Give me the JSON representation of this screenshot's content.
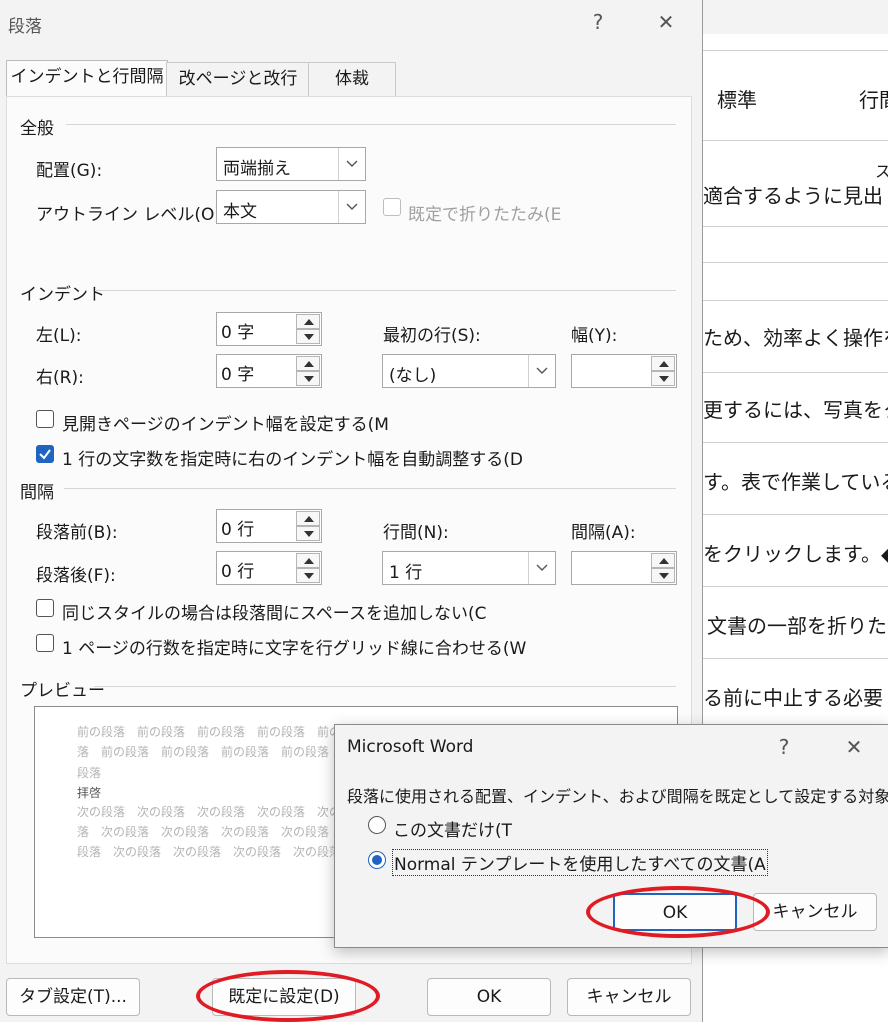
{
  "document": {
    "lines": [
      "標準",
      "行間",
      "ス",
      "適合するように見出",
      "ため、効率よく操作を",
      "更するには、写真をク",
      "す。表で作業している",
      "をクリックします。◆",
      "文書の一部を折りた",
      "る前に中止する必要"
    ]
  },
  "paragraph_dialog": {
    "title": "段落",
    "help": "?",
    "close": "✕",
    "tabs": [
      "インデントと行間隔",
      "改ページと改行",
      "体裁"
    ],
    "general": {
      "heading": "全般",
      "alignment_label": "配置(G):",
      "alignment_value": "両端揃え",
      "outline_label": "アウトライン レベル(O):",
      "outline_value": "本文",
      "collapse_label": "既定で折りたたみ(E"
    },
    "indent": {
      "heading": "インデント",
      "left_label": "左(L):",
      "left_value": "0 字",
      "right_label": "右(R):",
      "right_value": "0 字",
      "first_line_label": "最初の行(S):",
      "first_line_value": "(なし)",
      "width_label": "幅(Y):",
      "width_value": "",
      "mirror_label": "見開きページのインデント幅を設定する(M",
      "auto_adjust_label": "1 行の文字数を指定時に右のインデント幅を自動調整する(D"
    },
    "spacing": {
      "heading": "間隔",
      "before_label": "段落前(B):",
      "before_value": "0 行",
      "after_label": "段落後(F):",
      "after_value": "0 行",
      "line_label": "行間(N):",
      "line_value": "1 行",
      "at_label": "間隔(A):",
      "at_value": "",
      "no_space_label": "同じスタイルの場合は段落間にスペースを追加しない(C",
      "snap_grid_label": "1 ページの行数を指定時に文字を行グリッド線に合わせる(W"
    },
    "preview": {
      "heading": "プレビュー",
      "lines": [
        "前の段落　前の段落　前の段落　前の段落　前の段落",
        "落　前の段落　前の段落　前の段落　前の段落　前の段落",
        "段落",
        "拝啓",
        "次の段落　次の段落　次の段落　次の段落　次の段落",
        "落　次の段落　次の段落　次の段落　次の段落　次の段落",
        "段落　次の段落　次の段落　次の段落　次の段落　次の段落"
      ]
    },
    "buttons": {
      "tabs": "タブ設定(T)...",
      "set_default": "既定に設定(D)",
      "ok": "OK",
      "cancel": "キャンセル"
    }
  },
  "word_dialog": {
    "title": "Microsoft Word",
    "help": "?",
    "close": "✕",
    "message": "段落に使用される配置、インデント、および間隔を既定として設定する対象:",
    "option_this_doc": "この文書だけ(T",
    "option_normal": "Normal テンプレートを使用したすべての文書(A",
    "ok": "OK",
    "cancel": "キャンセル"
  },
  "colors": {
    "accent": "#1f64c0",
    "highlight_ellipse": "#e01b24"
  }
}
